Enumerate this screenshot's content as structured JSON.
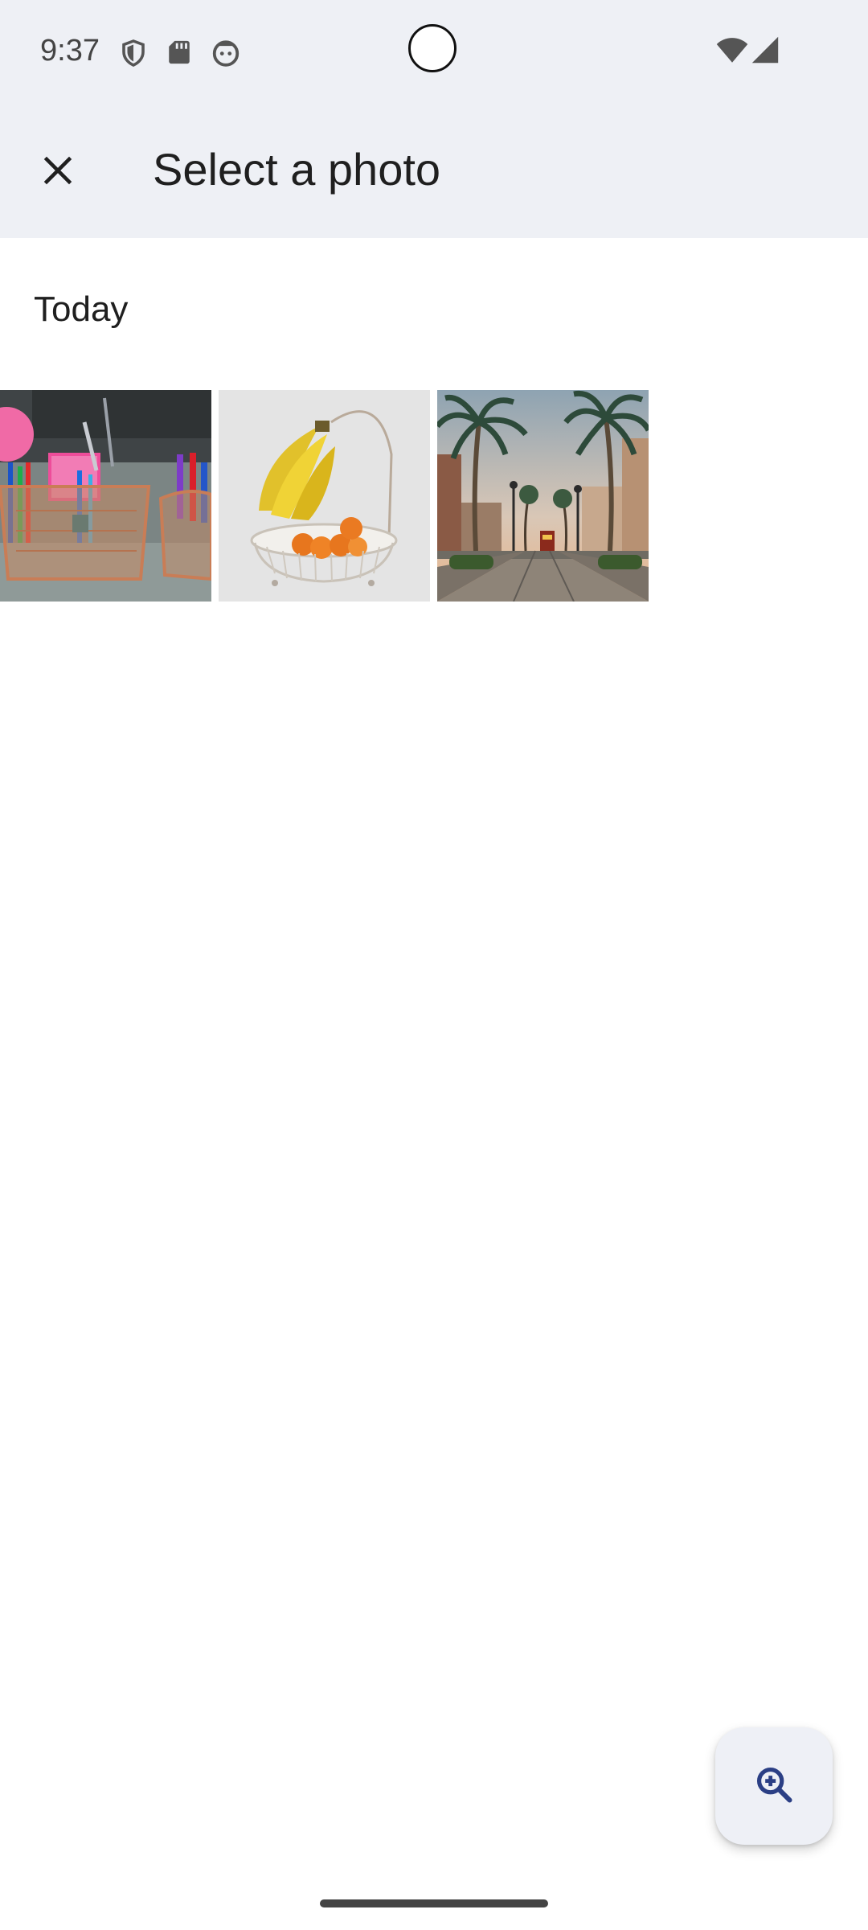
{
  "status_bar": {
    "time": "9:37",
    "left_icons": [
      "shield-icon",
      "sd-card-icon",
      "android-face-icon"
    ],
    "right_icons": [
      "wifi-icon",
      "cell-signal-icon"
    ]
  },
  "app_bar": {
    "close_icon": "close-icon",
    "title": "Select a photo"
  },
  "section": {
    "header": "Today"
  },
  "photos": [
    {
      "subject": "desk-organizer-photo"
    },
    {
      "subject": "banana-fruit-basket-photo"
    },
    {
      "subject": "palm-tree-street-photo"
    }
  ],
  "fab": {
    "icon": "zoom-in-icon",
    "accent": "#2b3f85"
  },
  "colors": {
    "app_bar_bg": "#eef0f5",
    "fab_bg": "#eef0f6"
  }
}
